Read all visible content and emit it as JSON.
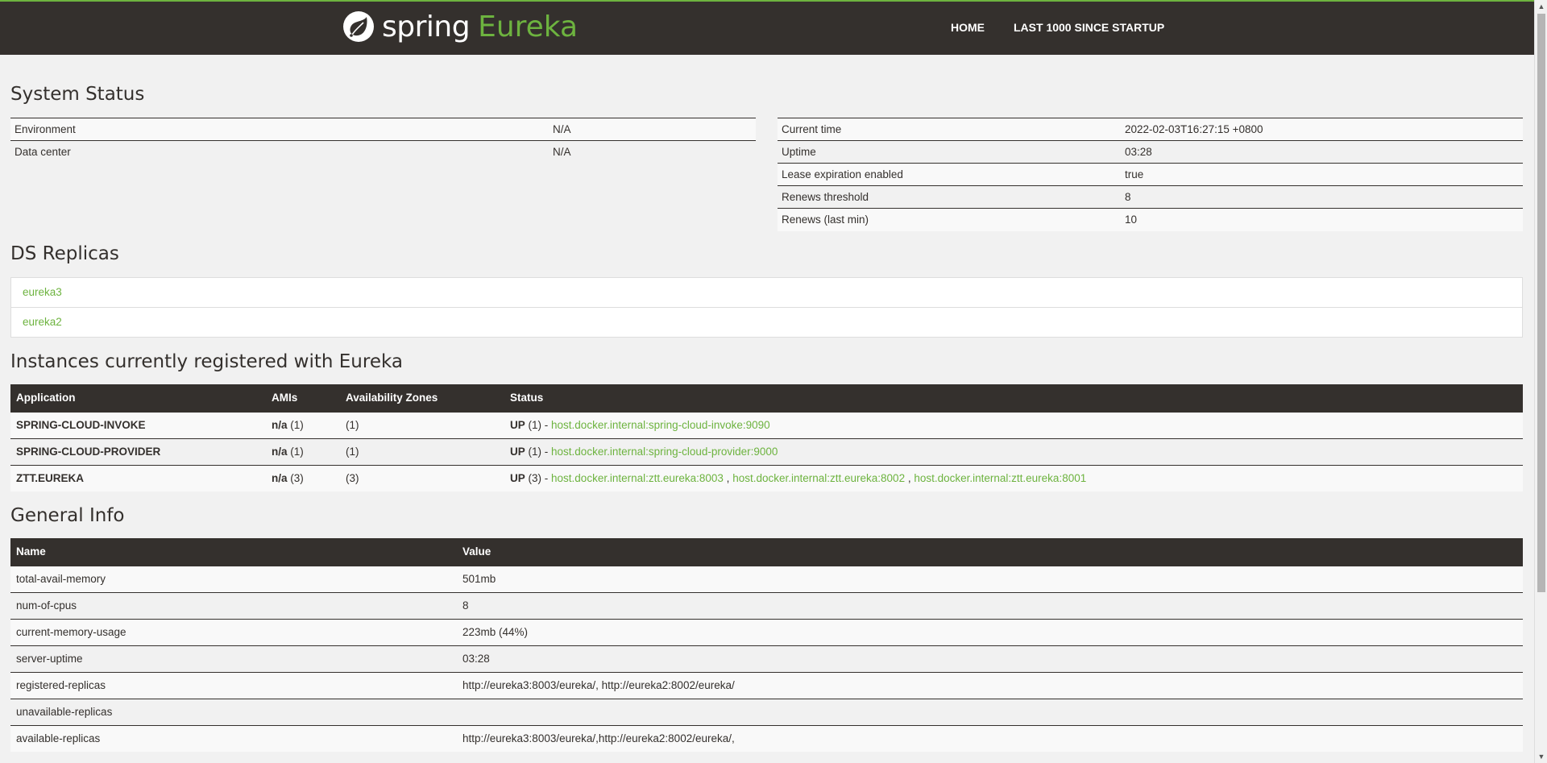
{
  "brand": {
    "spring": "spring",
    "eureka": "Eureka"
  },
  "nav": {
    "home": "HOME",
    "last": "LAST 1000 SINCE STARTUP"
  },
  "system_status": {
    "title": "System Status",
    "left": [
      {
        "label": "Environment",
        "value": "N/A"
      },
      {
        "label": "Data center",
        "value": "N/A"
      }
    ],
    "right": [
      {
        "label": "Current time",
        "value": "2022-02-03T16:27:15 +0800"
      },
      {
        "label": "Uptime",
        "value": "03:28"
      },
      {
        "label": "Lease expiration enabled",
        "value": "true"
      },
      {
        "label": "Renews threshold",
        "value": "8"
      },
      {
        "label": "Renews (last min)",
        "value": "10"
      }
    ]
  },
  "ds_replicas": {
    "title": "DS Replicas",
    "items": [
      "eureka3",
      "eureka2"
    ]
  },
  "instances": {
    "title": "Instances currently registered with Eureka",
    "headers": [
      "Application",
      "AMIs",
      "Availability Zones",
      "Status"
    ],
    "rows": [
      {
        "app": "SPRING-CLOUD-INVOKE",
        "ami_na": "n/a",
        "ami_count": "(1)",
        "zones": "(1)",
        "up": "UP",
        "up_count": "(1) - ",
        "links": [
          "host.docker.internal:spring-cloud-invoke:9090"
        ]
      },
      {
        "app": "SPRING-CLOUD-PROVIDER",
        "ami_na": "n/a",
        "ami_count": "(1)",
        "zones": "(1)",
        "up": "UP",
        "up_count": "(1) - ",
        "links": [
          "host.docker.internal:spring-cloud-provider:9000"
        ]
      },
      {
        "app": "ZTT.EUREKA",
        "ami_na": "n/a",
        "ami_count": "(3)",
        "zones": "(3)",
        "up": "UP",
        "up_count": "(3) - ",
        "links": [
          "host.docker.internal:ztt.eureka:8003",
          "host.docker.internal:ztt.eureka:8002",
          "host.docker.internal:ztt.eureka:8001"
        ]
      }
    ],
    "link_separator": " , "
  },
  "general_info": {
    "title": "General Info",
    "headers": [
      "Name",
      "Value"
    ],
    "rows": [
      {
        "name": "total-avail-memory",
        "value": "501mb"
      },
      {
        "name": "num-of-cpus",
        "value": "8"
      },
      {
        "name": "current-memory-usage",
        "value": "223mb (44%)"
      },
      {
        "name": "server-uptime",
        "value": "03:28"
      },
      {
        "name": "registered-replicas",
        "value": "http://eureka3:8003/eureka/, http://eureka2:8002/eureka/"
      },
      {
        "name": "unavailable-replicas",
        "value": ""
      },
      {
        "name": "available-replicas",
        "value": "http://eureka3:8003/eureka/,http://eureka2:8002/eureka/,"
      }
    ]
  },
  "colors": {
    "brand_green": "#6db33f",
    "dark": "#34302d",
    "background": "#f1f1f1"
  },
  "icons": {
    "logo": "spring-leaf-icon",
    "scroll_up": "scroll-up-arrow-icon",
    "scroll_down": "scroll-down-arrow-icon"
  }
}
